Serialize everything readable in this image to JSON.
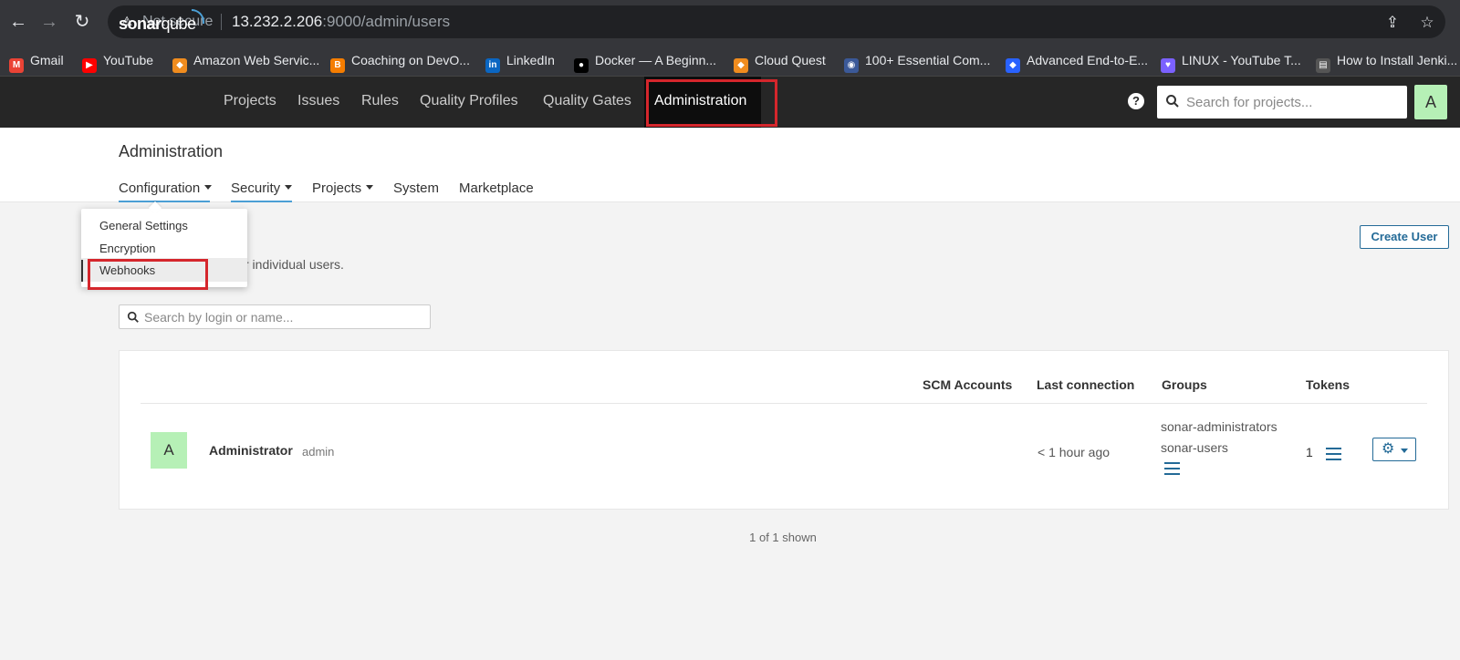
{
  "browser": {
    "security": "Not secure",
    "url_host": "13.232.2.206",
    "url_rest": ":9000/admin/users",
    "bookmarks": [
      {
        "label": "Gmail",
        "icon": "gmail-icon",
        "color": "#ea4335"
      },
      {
        "label": "YouTube",
        "icon": "youtube-icon",
        "color": "#ff0000"
      },
      {
        "label": "Amazon Web Servic...",
        "icon": "aws-icon",
        "color": "#f08c1e"
      },
      {
        "label": "Coaching on DevO...",
        "icon": "blogger-icon",
        "color": "#f57d00"
      },
      {
        "label": "LinkedIn",
        "icon": "linkedin-icon",
        "color": "#0a66c2"
      },
      {
        "label": "Docker — A Beginn...",
        "icon": "medium-icon",
        "color": "#000000"
      },
      {
        "label": "Cloud Quest",
        "icon": "aws-icon",
        "color": "#f08c1e"
      },
      {
        "label": "100+ Essential Com...",
        "icon": "globe-icon",
        "color": "#3b5998"
      },
      {
        "label": "Advanced End-to-E...",
        "icon": "diamond-icon",
        "color": "#2962ff"
      },
      {
        "label": "LINUX - YouTube T...",
        "icon": "heart-icon",
        "color": "#7b61ff"
      },
      {
        "label": "How to Install Jenki...",
        "icon": "page-icon",
        "color": "#555555"
      }
    ]
  },
  "nav": {
    "logo_bold": "sonar",
    "logo_light": "qube",
    "items": [
      "Projects",
      "Issues",
      "Rules",
      "Quality Profiles",
      "Quality Gates",
      "Administration"
    ],
    "search_placeholder": "Search for projects...",
    "avatar_letter": "A"
  },
  "admin": {
    "title": "Administration",
    "tabs": [
      "Configuration",
      "Security",
      "Projects",
      "System",
      "Marketplace"
    ]
  },
  "dropdown": {
    "items": [
      "General Settings",
      "Encryption",
      "Webhooks"
    ]
  },
  "users_page": {
    "description": "r individual users.",
    "create_button": "Create User",
    "search_placeholder": "Search by login or name...",
    "columns": [
      "SCM Accounts",
      "Last connection",
      "Groups",
      "Tokens"
    ],
    "rows": [
      {
        "avatar": "A",
        "name": "Administrator",
        "login": "admin",
        "last_connection": "< 1 hour ago",
        "groups": [
          "sonar-administrators",
          "sonar-users"
        ],
        "tokens": "1"
      }
    ],
    "footer": "1 of 1 shown"
  },
  "colors": {
    "accent": "#4b9fd5",
    "link": "#236a97",
    "highlight": "#d5262c",
    "avatar": "#b6f0b6"
  }
}
